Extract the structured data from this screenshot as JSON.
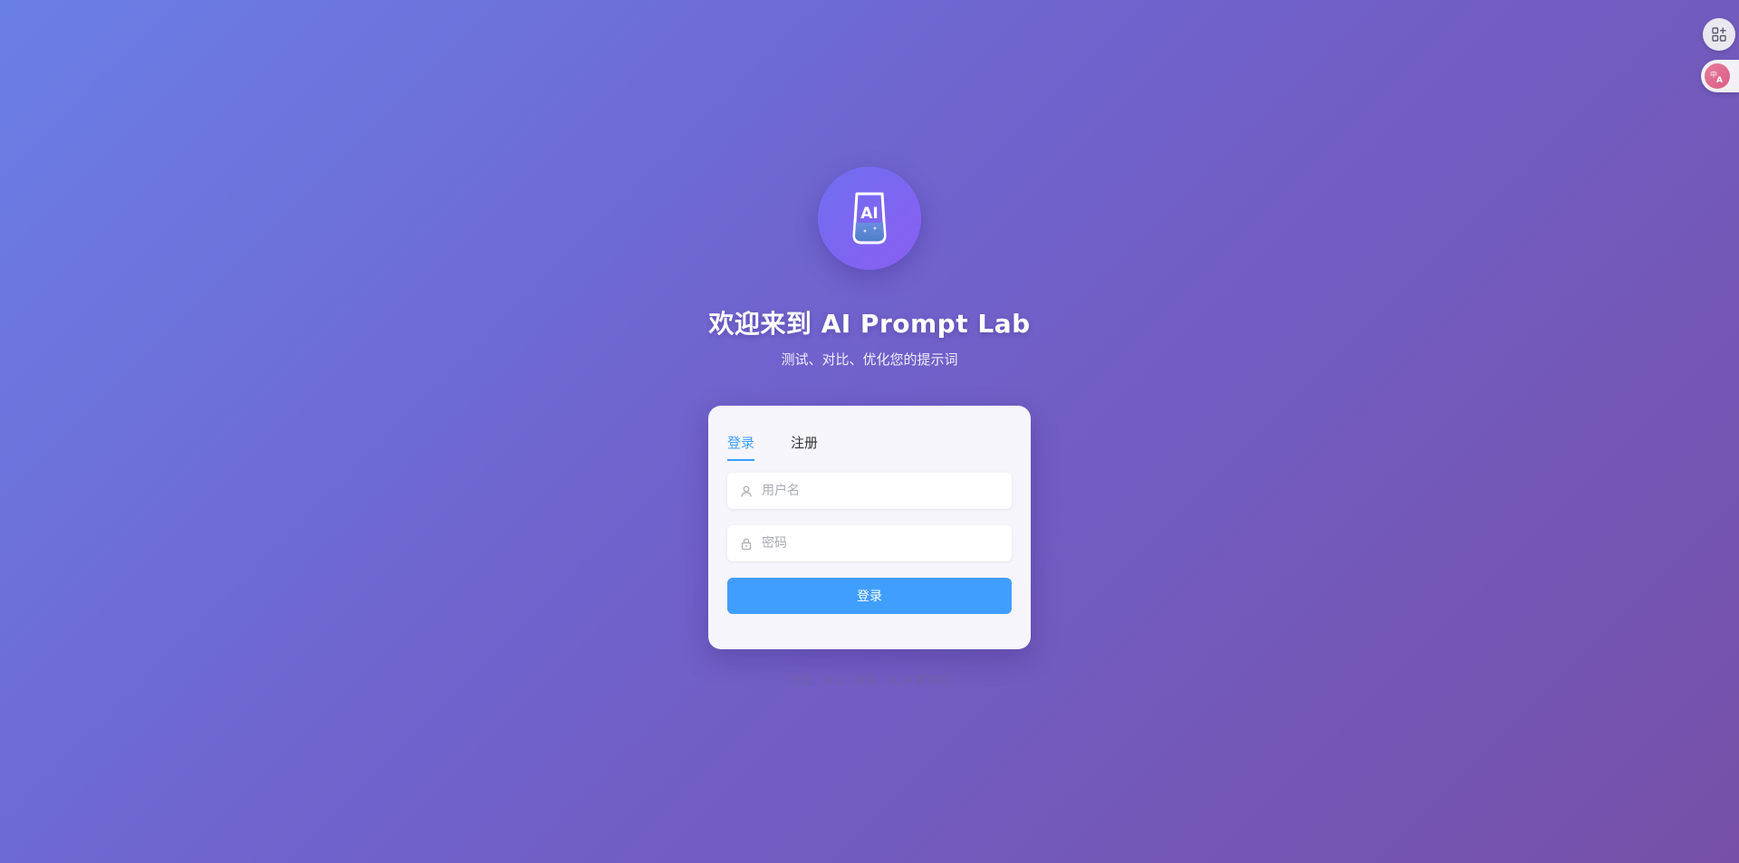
{
  "logo": {
    "text": "AI"
  },
  "header": {
    "title": "欢迎来到 AI Prompt Lab",
    "subtitle": "测试、对比、优化您的提示词"
  },
  "auth": {
    "tabs": [
      {
        "label": "登录",
        "active": true
      },
      {
        "label": "注册",
        "active": false
      }
    ],
    "username_placeholder": "用户名",
    "password_placeholder": "密码",
    "submit_label": "登录"
  },
  "footer": {
    "links": [
      "测试",
      "对比",
      "优化",
      "让 AI 更懂你"
    ]
  },
  "side_tools": {
    "apps_icon": "apps-add-icon",
    "translate_icon": "translate-icon"
  },
  "colors": {
    "accent": "#409eff",
    "background_start": "#6a7fe6",
    "background_end": "#7650a8",
    "logo_gradient_start": "#6f6ff0",
    "logo_gradient_end": "#8a5ef2"
  }
}
